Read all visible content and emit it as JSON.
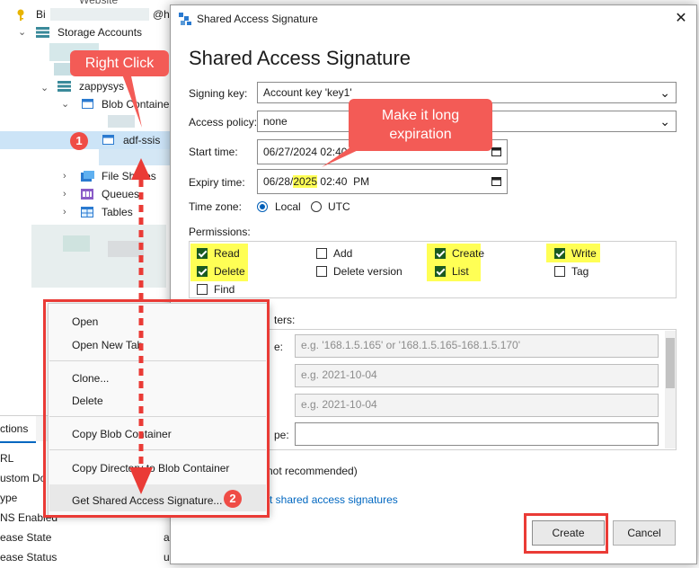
{
  "explorer": {
    "top_partial": "Website",
    "row_bi": "Bi",
    "row_bi_suffix": "@h",
    "storage_accounts": "Storage Accounts",
    "account": "zappysys",
    "blob_containers": "Blob Containe",
    "selected_container": "adf-ssis",
    "file_shares": "File Shares",
    "queues": "Queues",
    "tables": "Tables"
  },
  "bottom_panel": {
    "tab": "ctions",
    "rows": [
      "RL",
      "ustom Do",
      "ype",
      "NS Enabled",
      "ease State",
      "ease Status"
    ],
    "values": [
      "",
      "",
      "",
      "",
      "a",
      "u"
    ]
  },
  "context_menu": {
    "items": [
      "Open",
      "Open New Tab",
      "Clone...",
      "Delete",
      "Copy Blob Container",
      "Copy Directory to Blob Container",
      "Get Shared Access Signature..."
    ]
  },
  "dialog": {
    "window_title": "Shared Access Signature",
    "heading": "Shared Access Signature",
    "signing_key_label": "Signing key:",
    "signing_key_value": "Account key 'key1'",
    "access_policy_label": "Access policy:",
    "access_policy_value": "none",
    "start_time_label": "Start time:",
    "start_time_value": "06/27/2024  02:40",
    "expiry_time_label": "Expiry time:",
    "expiry_prefix": "06/28/",
    "expiry_year": "2025",
    "expiry_suffix": " 02:40  PM",
    "time_zone_label": "Time zone:",
    "tz_local": "Local",
    "tz_utc": "UTC",
    "permissions_label": "Permissions:",
    "permissions": [
      {
        "label": "Read",
        "checked": true
      },
      {
        "label": "Add",
        "checked": false
      },
      {
        "label": "Create",
        "checked": true
      },
      {
        "label": "Write",
        "checked": true
      },
      {
        "label": "Delete",
        "checked": true
      },
      {
        "label": "Delete version",
        "checked": false
      },
      {
        "label": "List",
        "checked": true
      },
      {
        "label": "Tag",
        "checked": false
      },
      {
        "label": "Find",
        "checked": false
      }
    ],
    "optional_params_label_partial": "ters:",
    "ip_label_partial": "e:",
    "ip_placeholder": "e.g. '168.1.5.165' or '168.1.5.165-168.1.5.170'",
    "date_placeholder_1": "e.g. 2021-10-04",
    "date_placeholder_2": "e.g. 2021-10-04",
    "type_label_partial": "pe:",
    "not_recommended": "not recommended)",
    "link_partial": "t shared access signatures",
    "create_button": "Create",
    "cancel_button": "Cancel"
  },
  "annotations": {
    "right_click": "Right Click",
    "make_long_1": "Make it long",
    "make_long_2": "expiration",
    "badge_1": "1",
    "badge_2": "2"
  },
  "colors": {
    "annotation_red": "#f35b56",
    "highlight_yellow": "#ffff55",
    "selection_blue": "#cce4f7",
    "link_blue": "#0067c0"
  }
}
